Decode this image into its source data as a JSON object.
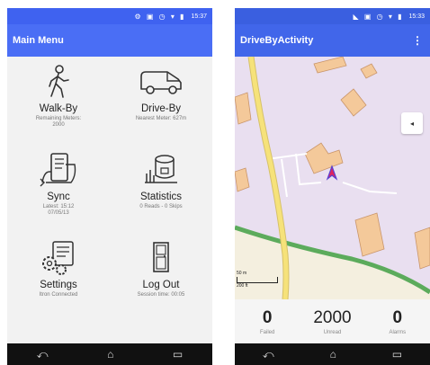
{
  "left": {
    "status_icons": "⚙ ▣ ◷ ▾ ▮",
    "status_time": "15:37",
    "app_title": "Main Menu",
    "tiles": [
      {
        "title": "Walk-By",
        "sub": "Remaining Meters:\n2000"
      },
      {
        "title": "Drive-By",
        "sub": "Nearest Meter: 627m"
      },
      {
        "title": "Sync",
        "sub": "Latest: 15:12\n07/05/13"
      },
      {
        "title": "Statistics",
        "sub": "0 Reads - 0 Skips"
      },
      {
        "title": "Settings",
        "sub": "Itron Connected"
      },
      {
        "title": "Log Out",
        "sub": "Session time: 00:05"
      }
    ],
    "nav": [
      "⤺",
      "⌂",
      "▭"
    ]
  },
  "right": {
    "status_icons": "◣ ▣ ◷ ▾ ▮",
    "status_time": "15:33",
    "app_title": "DriveByActivity",
    "overflow": "⋮",
    "compass": "◂",
    "scale_m": "50 m",
    "scale_ft": "200 ft",
    "stats": [
      {
        "value": "0",
        "label": "Failed"
      },
      {
        "value": "2000",
        "label": "Unread"
      },
      {
        "value": "0",
        "label": "Alarms"
      }
    ],
    "nav": [
      "⤺",
      "⌂",
      "▭"
    ]
  },
  "colors": {
    "primary": "#4a6ef5",
    "map_bg": "#e9dff0",
    "road": "#f6e27a",
    "building": "#f4c99a",
    "park": "#5cab5c",
    "marker": "#e0245e"
  }
}
